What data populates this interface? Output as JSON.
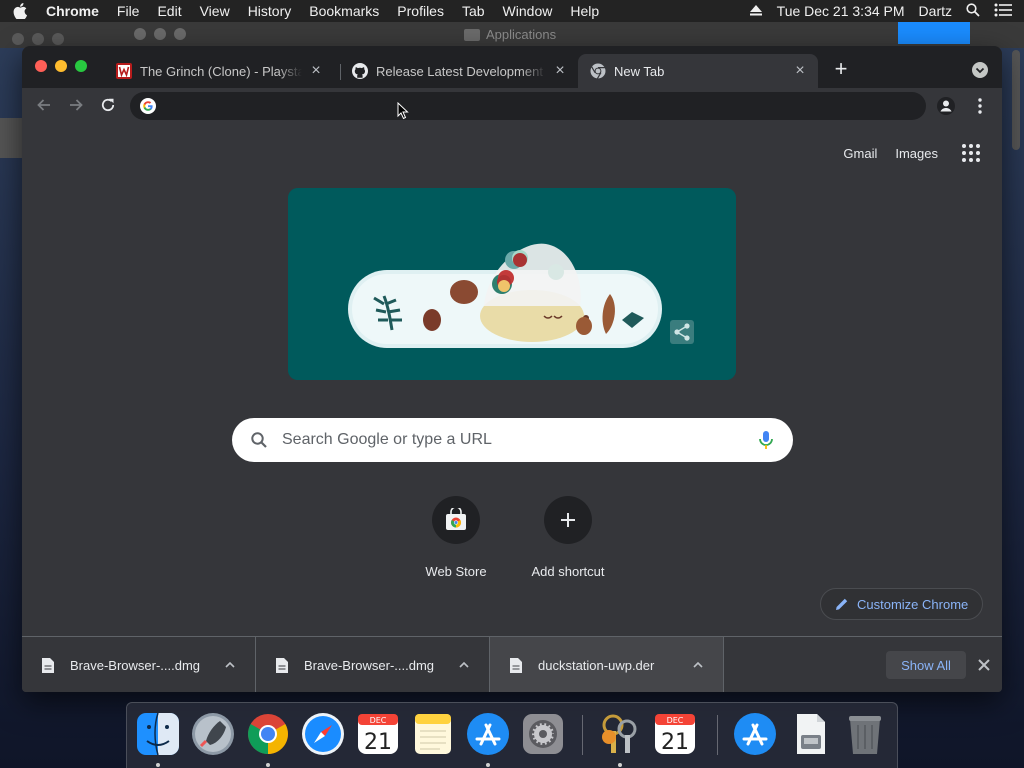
{
  "menubar": {
    "app": "Chrome",
    "items": [
      "File",
      "Edit",
      "View",
      "History",
      "Bookmarks",
      "Profiles",
      "Tab",
      "Window",
      "Help"
    ],
    "datetime": "Tue Dec 21  3:34 PM",
    "user": "Dartz"
  },
  "background_window": {
    "title": "Applications"
  },
  "tabs": [
    {
      "title": "The Grinch (Clone) - Playstation",
      "active": false
    },
    {
      "title": "Release Latest Development Build",
      "active": false
    },
    {
      "title": "New Tab",
      "active": true
    }
  ],
  "toolbar": {
    "omnibox_value": ""
  },
  "ntp": {
    "gmail": "Gmail",
    "images": "Images",
    "search_placeholder": "Search Google or type a URL",
    "shortcuts": [
      {
        "label": "Web Store"
      },
      {
        "label": "Add shortcut"
      }
    ],
    "customize": "Customize Chrome"
  },
  "downloads": [
    {
      "name": "Brave-Browser-....dmg"
    },
    {
      "name": "Brave-Browser-....dmg"
    },
    {
      "name": "duckstation-uwp.der"
    }
  ],
  "show_all": "Show All",
  "dock": {
    "calendar_month": "DEC",
    "calendar_day": "21",
    "apps": [
      "finder-icon",
      "launchpad-icon",
      "chrome-icon",
      "safari-icon",
      "calendar-icon",
      "notes-icon",
      "app-store-icon",
      "system-preferences-icon",
      "keychain-access-icon",
      "calendar-icon",
      "app-store-icon",
      "installer-icon",
      "trash-icon"
    ]
  },
  "colors": {
    "tabstrip": "#202124",
    "toolbar": "#35363a",
    "doodle_bg": "#005a5c",
    "accent_link": "#8ab4f8"
  }
}
